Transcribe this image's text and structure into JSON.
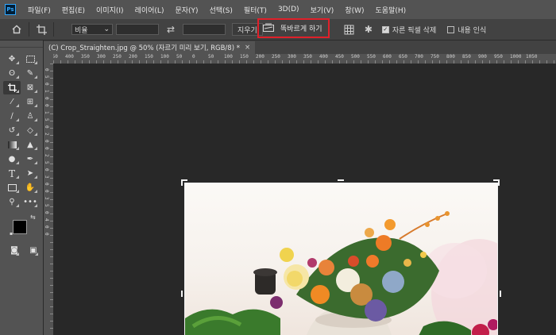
{
  "app": {
    "logo": "Ps"
  },
  "menubar": {
    "items": [
      "파일(F)",
      "편집(E)",
      "이미지(I)",
      "레이어(L)",
      "문자(Y)",
      "선택(S)",
      "필터(T)",
      "3D(D)",
      "보기(V)",
      "창(W)",
      "도움말(H)"
    ]
  },
  "options": {
    "home_icon": "home-icon",
    "crop_icon": "crop-icon",
    "ratio_select": "비율",
    "swap_icon": "swap-icon",
    "clear_label": "지우기",
    "straighten_label": "똑바르게 하기",
    "grid_icon": "grid-overlay-icon",
    "settings_icon": "gear-icon",
    "delete_cropped": {
      "label": "자른 픽셀 삭제",
      "checked": true
    },
    "content_aware": {
      "label": "내용 인식",
      "checked": false
    },
    "highlight_color": "#e0202a"
  },
  "document": {
    "tab_title": "(C) Crop_Straighten.jpg @ 50% (자르기 미리 보기, RGB/8) *",
    "close_glyph": "×"
  },
  "ruler": {
    "top_labels": [
      "450",
      "400",
      "350",
      "300",
      "250",
      "200",
      "150",
      "100",
      "50",
      "0",
      "50",
      "100",
      "150",
      "200",
      "250",
      "300",
      "350",
      "400",
      "450",
      "500",
      "550",
      "600",
      "650",
      "700",
      "750",
      "800",
      "850",
      "900",
      "950",
      "1000",
      "1050"
    ],
    "left_labels": [
      "0",
      "5",
      "0",
      "1",
      "0",
      "0",
      "1",
      "5",
      "0",
      "2",
      "0",
      "0",
      "2",
      "5",
      "0",
      "3",
      "0",
      "0",
      "3",
      "5",
      "0",
      "4",
      "0",
      "0"
    ]
  },
  "toolbar": {
    "tools": [
      "move-icon",
      "marquee-icon",
      "lasso-icon",
      "quick-select-icon",
      "crop-icon",
      "frame-icon",
      "eyedropper-icon",
      "patch-icon",
      "brush-icon",
      "stamp-icon",
      "history-brush-icon",
      "eraser-icon",
      "gradient-icon",
      "blur-icon",
      "dodge-icon",
      "pen-icon",
      "type-icon",
      "path-select-icon",
      "rectangle-icon",
      "hand-icon",
      "zoom-icon",
      "more-icon"
    ],
    "foreground": "#000000",
    "background": "#ffffff"
  }
}
